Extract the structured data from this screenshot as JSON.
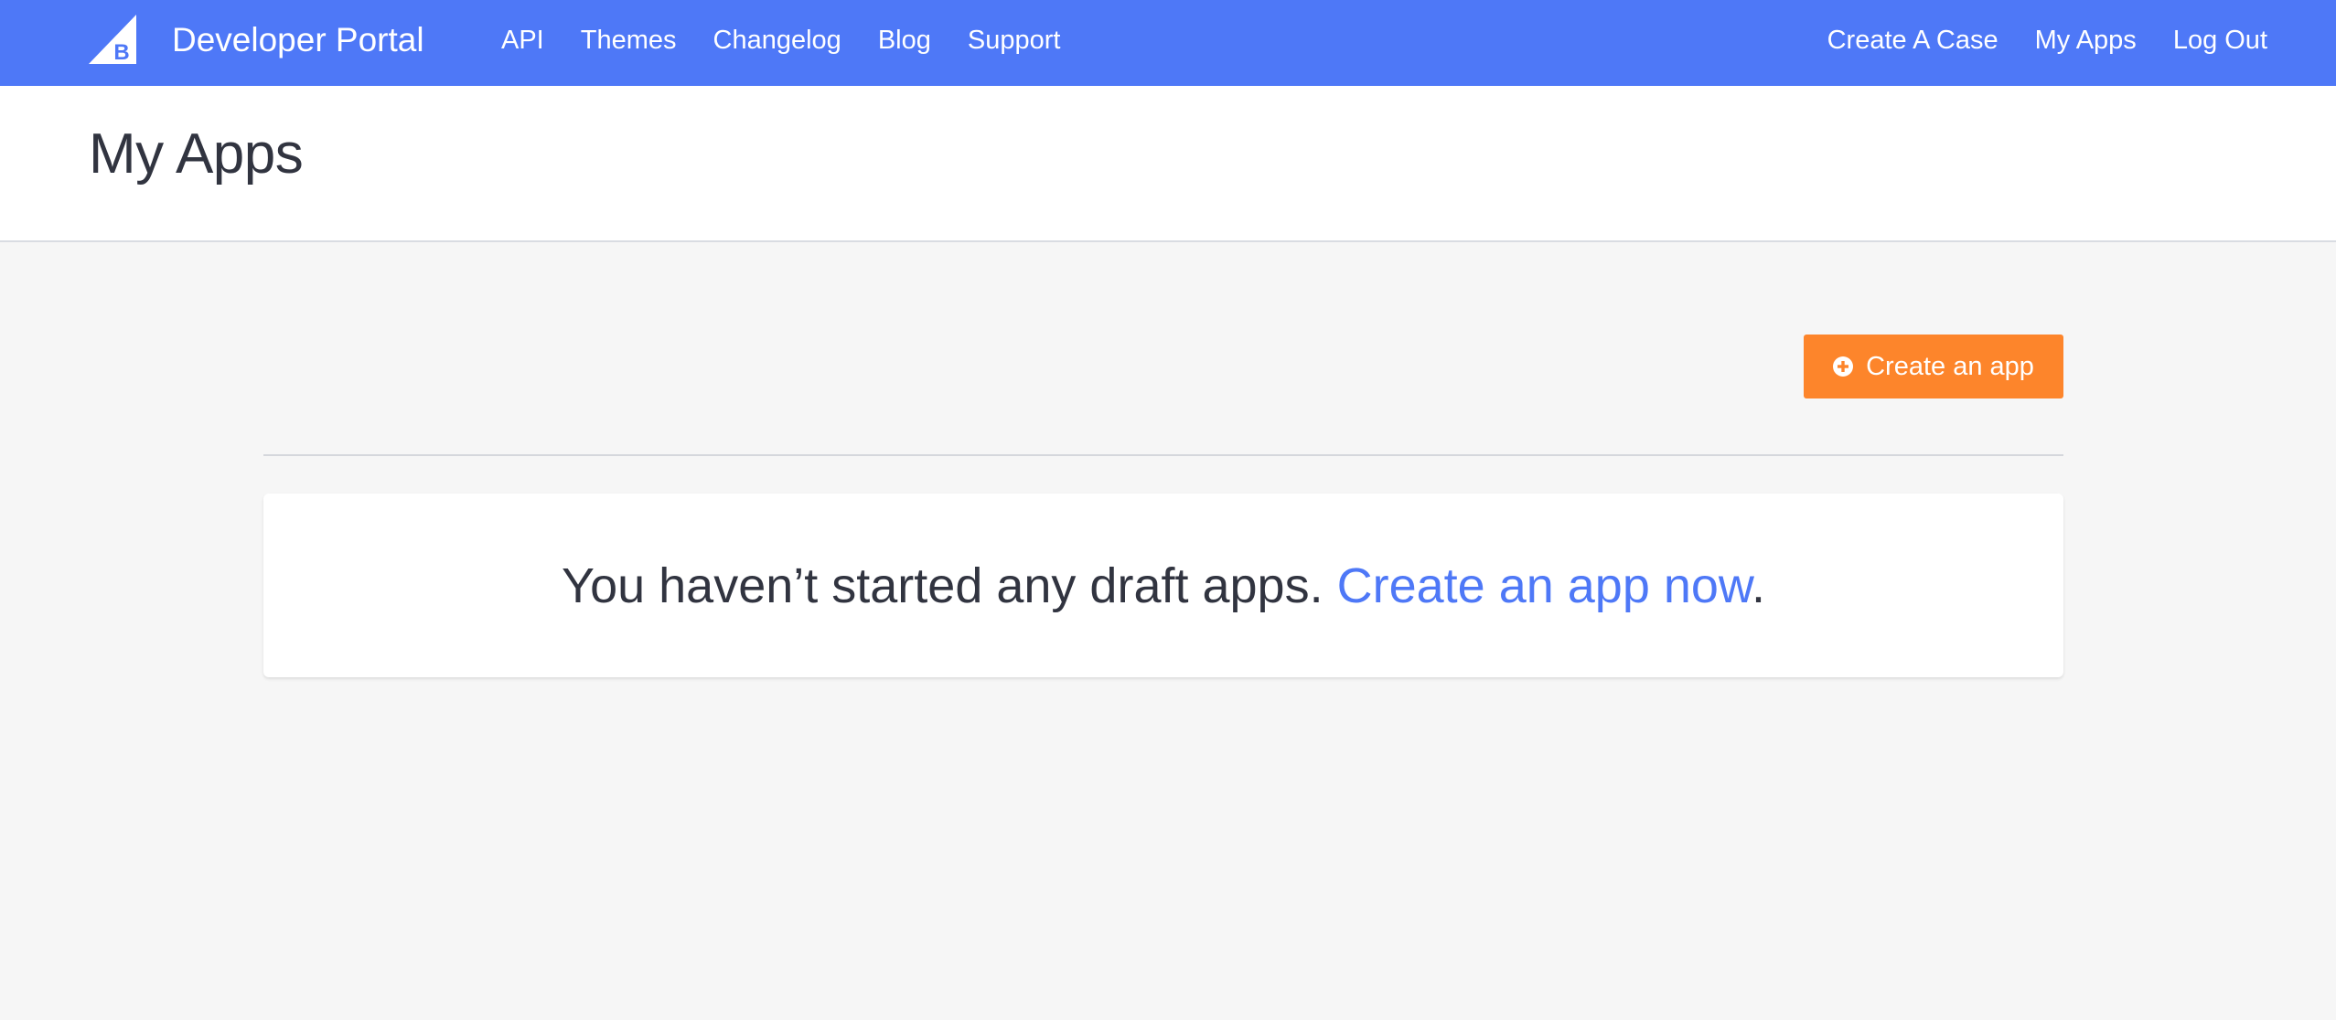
{
  "topbar": {
    "brand": "Developer Portal",
    "logo_letter": "B",
    "nav_left": [
      "API",
      "Themes",
      "Changelog",
      "Blog",
      "Support"
    ],
    "nav_right": [
      "Create A Case",
      "My Apps",
      "Log Out"
    ]
  },
  "page": {
    "title": "My Apps"
  },
  "actions": {
    "create_button_label": "Create an app",
    "create_button_icon": "plus-circle-icon"
  },
  "empty_state": {
    "message": "You haven’t started any draft apps.",
    "link_text": "Create an app now",
    "trailing": "."
  },
  "colors": {
    "nav_bg": "#4e78f7",
    "accent_orange": "#fd852b",
    "link_blue": "#4e78f7",
    "page_bg": "#f6f6f6",
    "text": "#313440"
  }
}
